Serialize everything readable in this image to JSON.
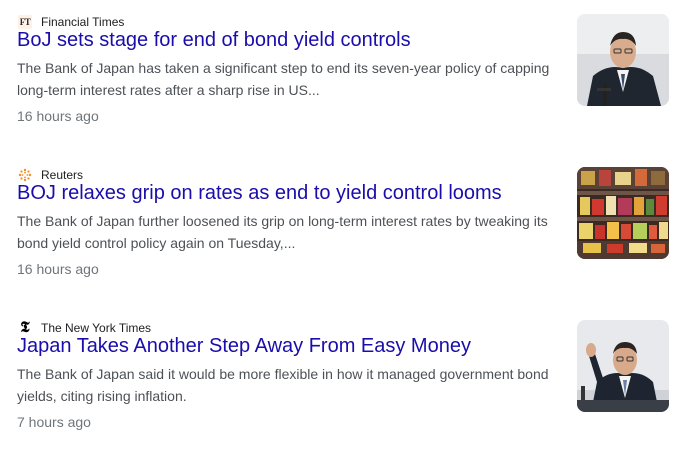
{
  "colors": {
    "title": "#1a0dab",
    "snippet": "#4d5156",
    "time": "#70757a",
    "source": "#202124"
  },
  "articles": [
    {
      "source_icon": "ft-logo-icon",
      "source_icon_text": "FT",
      "source": "Financial Times",
      "title": "BoJ sets stage for end of bond yield controls",
      "snippet": "The Bank of Japan has taken a significant step to end its seven-year policy of capping long-term interest rates after a sharp rise in US...",
      "time": "16 hours ago"
    },
    {
      "source_icon": "reuters-logo-icon",
      "source": "Reuters",
      "title": "BOJ relaxes grip on rates as end to yield control looms",
      "snippet": "The Bank of Japan further loosened its grip on long-term interest rates by tweaking its bond yield control policy again on Tuesday,...",
      "time": "16 hours ago"
    },
    {
      "source_icon": "nyt-logo-icon",
      "source_icon_text": "𝕿",
      "source": "The New York Times",
      "title": "Japan Takes Another Step Away From Easy Money",
      "snippet": "The Bank of Japan said it would be more flexible in how it managed government bond yields, citing rising inflation.",
      "time": "7 hours ago"
    }
  ]
}
